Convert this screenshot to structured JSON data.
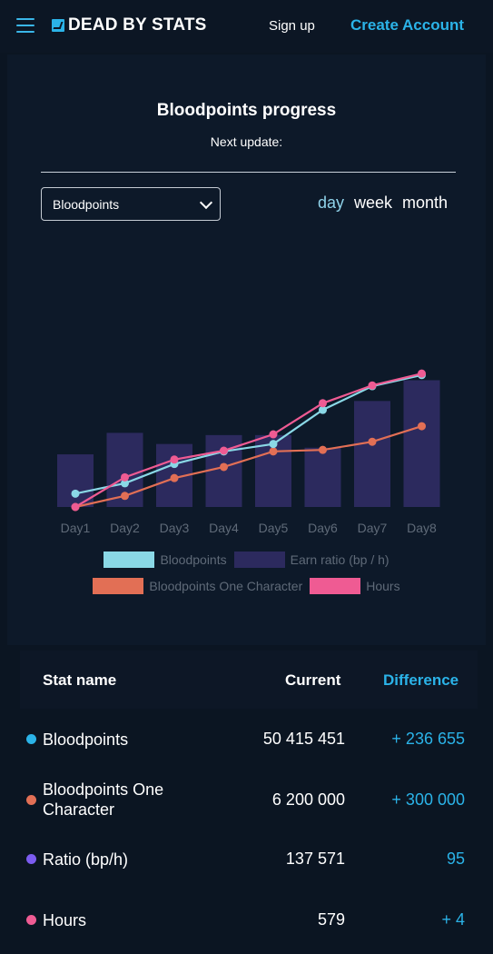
{
  "header": {
    "logo_text": "DEAD BY STATS",
    "signup_label": "Sign up",
    "create_label": "Create Account"
  },
  "section": {
    "title": "Bloodpoints progress",
    "subtitle": "Next update:"
  },
  "controls": {
    "select_value": "Bloodpoints",
    "ranges": [
      "day",
      "week",
      "month"
    ],
    "active_range": "day"
  },
  "colors": {
    "accent": "#2bb3e8",
    "bloodpoints": "#8ad8e6",
    "earn_ratio": "#2c2a5e",
    "one_character": "#e26f55",
    "hours": "#ef5b93"
  },
  "chart_data": {
    "type": "bar+line",
    "categories": [
      "Day1",
      "Day2",
      "Day3",
      "Day4",
      "Day5",
      "Day6",
      "Day7",
      "Day8"
    ],
    "series": [
      {
        "name": "Bloodpoints",
        "kind": "line",
        "values": [
          0.18,
          0.32,
          0.58,
          0.75,
          0.85,
          1.31,
          1.63,
          1.78
        ]
      },
      {
        "name": "Earn ratio (bp / h)",
        "kind": "bar",
        "values": [
          0.71,
          1.0,
          0.85,
          0.97,
          0.97,
          0.8,
          1.43,
          1.71
        ]
      },
      {
        "name": "Bloodpoints One Character",
        "kind": "line",
        "values": [
          0.0,
          0.15,
          0.39,
          0.54,
          0.75,
          0.77,
          0.88,
          1.09
        ]
      },
      {
        "name": "Hours",
        "kind": "line",
        "values": [
          0.0,
          0.4,
          0.64,
          0.76,
          0.98,
          1.4,
          1.64,
          1.8
        ]
      }
    ],
    "legend": [
      "Bloodpoints",
      "Earn ratio (bp / h)",
      "Bloodpoints One Character",
      "Hours"
    ],
    "legend_placement": "bottom",
    "ylim": [
      0,
      1.9
    ],
    "grid": false
  },
  "table": {
    "headers": {
      "name": "Stat name",
      "current": "Current",
      "difference": "Difference"
    },
    "rows": [
      {
        "name": "Bloodpoints",
        "current": "50 415 451",
        "difference": "+ 236 655",
        "dot": "#2bb3e8"
      },
      {
        "name": "Bloodpoints One Character",
        "current": "6 200 000",
        "difference": "+ 300 000",
        "dot": "#e26f55"
      },
      {
        "name": "Ratio (bp/h)",
        "current": "137 571",
        "difference": "95",
        "dot": "#7c5cf0"
      },
      {
        "name": "Hours",
        "current": "579",
        "difference": "+ 4",
        "dot": "#ef5b93"
      }
    ]
  }
}
